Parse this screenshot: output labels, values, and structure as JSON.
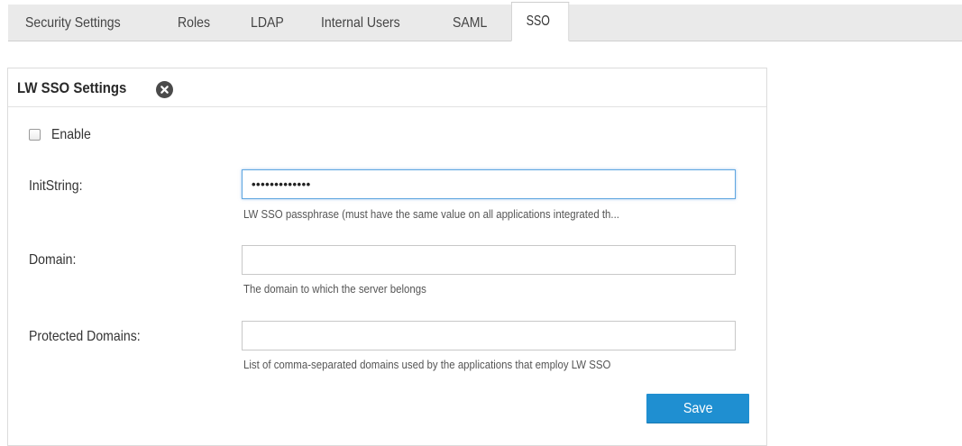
{
  "tabs": [
    {
      "label": "Security Settings"
    },
    {
      "label": "Roles"
    },
    {
      "label": "LDAP"
    },
    {
      "label": "Internal Users"
    },
    {
      "label": "SAML"
    },
    {
      "label": "SSO"
    }
  ],
  "active_tab": "SSO",
  "panel": {
    "title": "LW SSO Settings",
    "close_icon": "close-icon"
  },
  "form": {
    "enable": {
      "label": "Enable",
      "checked": false
    },
    "init_string": {
      "label": "InitString:",
      "value": "•••••••••••••",
      "hint": "LW SSO passphrase (must have the same value on all applications integrated th..."
    },
    "domain": {
      "label": "Domain:",
      "value": "",
      "hint": "The domain to which the server belongs"
    },
    "protected_domains": {
      "label": "Protected Domains:",
      "value": "",
      "hint": "List of comma-separated domains used by the applications that employ LW SSO"
    },
    "save_label": "Save"
  },
  "colors": {
    "accent": "#1f8fd1",
    "focus_border": "#5fa6e0",
    "tab_bar": "#eaeaea"
  }
}
